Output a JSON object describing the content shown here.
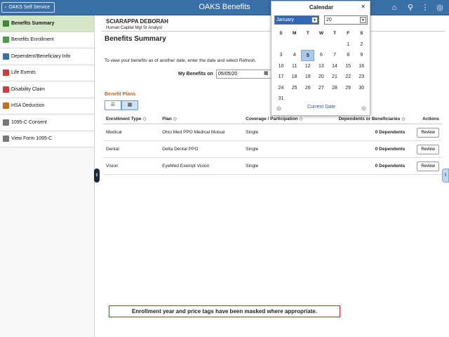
{
  "header": {
    "back_label": "OAKS Self Service",
    "title": "OAKS Benefits"
  },
  "sidebar": {
    "items": [
      {
        "label": "Benefits Summary",
        "icon": "benefits-summary-icon",
        "color": "#3a8a3a"
      },
      {
        "label": "Benefits Enrollment",
        "icon": "enrollment-icon",
        "color": "#4a9a4a"
      },
      {
        "label": "Dependent/Beneficiary Info",
        "icon": "dependents-icon",
        "color": "#3a6fa8"
      },
      {
        "label": "Life Events",
        "icon": "life-events-icon",
        "color": "#c94040"
      },
      {
        "label": "Disability Claim",
        "icon": "disability-icon",
        "color": "#c94040"
      },
      {
        "label": "HSA Deduction",
        "icon": "hsa-icon",
        "color": "#c07020"
      },
      {
        "label": "1095-C Consent",
        "icon": "consent-icon",
        "color": "#777"
      },
      {
        "label": "View Form 1095-C",
        "icon": "form-icon",
        "color": "#777"
      }
    ]
  },
  "employee": {
    "name": "SCIARAPPA DEBORAH",
    "title": "Human Capital Mgt Sr Analyst"
  },
  "main": {
    "page_title": "Benefits Summary",
    "instructions": "To view your benefits as of another date, enter the date and select Refresh.",
    "as_of_label": "My Benefits on",
    "as_of_value": "05/05/20"
  },
  "plans": {
    "section_title": "Benefit Plans",
    "columns": [
      "Enrollment Type",
      "Plan",
      "Coverage / Participation",
      "Dependents or Beneficiaries",
      "Actions"
    ],
    "rows": [
      {
        "type": "Medical",
        "plan": "Ohio Med PPO Medical Mutual",
        "coverage": "Single",
        "dependents": "0 Dependents",
        "action": "Review"
      },
      {
        "type": "Dental",
        "plan": "Delta Dental PPO",
        "coverage": "Single",
        "dependents": "0 Dependents",
        "action": "Review"
      },
      {
        "type": "Vision",
        "plan": "EyeMed Exempt Vision",
        "coverage": "Single",
        "dependents": "0 Dependents",
        "action": "Review"
      }
    ]
  },
  "note": "Enrollment year and price tags have been masked where appropriate.",
  "calendar": {
    "title": "Calendar",
    "month": "January",
    "year": "20",
    "weekdays": [
      "S",
      "M",
      "T",
      "W",
      "T",
      "F",
      "S"
    ],
    "weeks": [
      [
        "",
        "",
        "",
        "",
        "",
        "1",
        "2"
      ],
      [
        "3",
        "4",
        "5",
        "6",
        "7",
        "8",
        "9"
      ],
      [
        "10",
        "11",
        "12",
        "13",
        "14",
        "15",
        "16"
      ],
      [
        "17",
        "18",
        "19",
        "20",
        "21",
        "22",
        "23"
      ],
      [
        "24",
        "25",
        "26",
        "27",
        "28",
        "29",
        "30"
      ],
      [
        "31",
        "",
        "",
        "",
        "",
        "",
        ""
      ]
    ],
    "selected_day": "5",
    "footer": "Current Date"
  }
}
